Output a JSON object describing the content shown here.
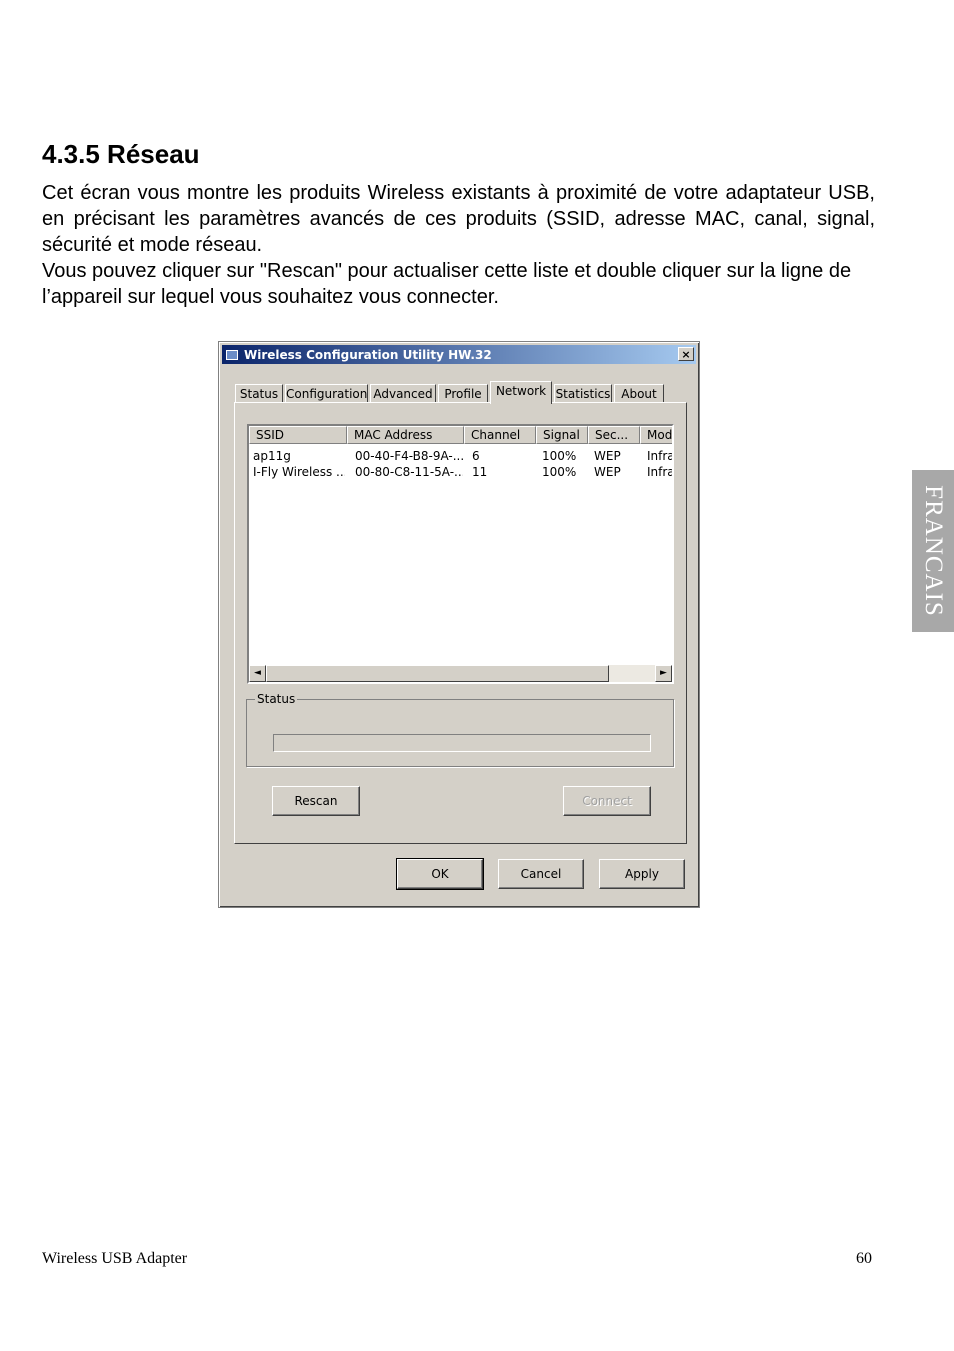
{
  "section": {
    "heading": "4.3.5 Réseau",
    "paragraph1": "Cet écran vous montre les produits Wireless existants à proximité de votre adaptateur USB, en précisant les paramètres avancés de ces produits (SSID, adresse MAC, canal, signal, sécurité et mode réseau.",
    "paragraph2": "Vous pouvez cliquer sur \"Rescan\" pour actualiser cette liste et double cliquer sur la ligne de l’appareil sur lequel vous souhaitez vous connecter."
  },
  "side_tab": {
    "label": "FRANCAIS"
  },
  "footer": {
    "left": "Wireless USB Adapter",
    "page": "60"
  },
  "dialog": {
    "title": "Wireless Configuration Utility HW.32",
    "close_label": "×",
    "tabs": [
      "Status",
      "Configuration",
      "Advanced",
      "Profile",
      "Network",
      "Statistics",
      "About"
    ],
    "active_tab": "Network",
    "list": {
      "columns": [
        "SSID",
        "MAC Address",
        "Channel",
        "Signal",
        "Sec...",
        "Mod"
      ],
      "rows": [
        [
          "ap11g",
          "00-40-F4-B8-9A-...",
          "6",
          "100%",
          "WEP",
          "Infra"
        ],
        [
          "I-Fly Wireless ...",
          "00-80-C8-11-5A-...",
          "11",
          "100%",
          "WEP",
          "Infra"
        ]
      ]
    },
    "status_group": {
      "label": "Status"
    },
    "buttons": {
      "rescan": "Rescan",
      "connect": "Connect",
      "ok": "OK",
      "cancel": "Cancel",
      "apply": "Apply"
    },
    "scroll": {
      "left_arrow": "◄",
      "right_arrow": "►"
    }
  }
}
